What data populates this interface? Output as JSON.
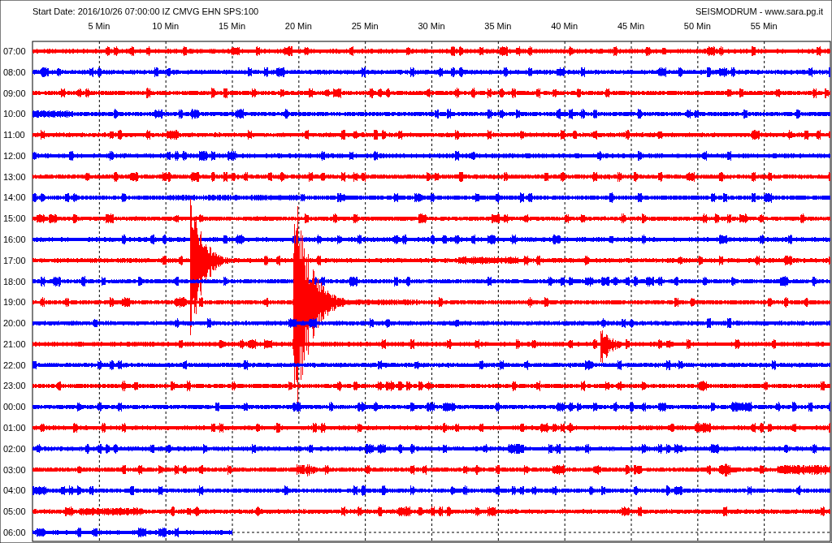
{
  "header": {
    "start_info": "Start Date: 2016/10/26 07:00:00 IZ CMVG EHN SPS:100",
    "site": "SEISMODRUM - www.sara.pg.it"
  },
  "x_ticks": [
    "5 Min",
    "10 Min",
    "15 Min",
    "20 Min",
    "25 Min",
    "30 Min",
    "35 Min",
    "40 Min",
    "45 Min",
    "50 Min",
    "55 Min"
  ],
  "rows": [
    {
      "label": "07:00",
      "color": "#ff0000"
    },
    {
      "label": "08:00",
      "color": "#0000ff"
    },
    {
      "label": "09:00",
      "color": "#ff0000"
    },
    {
      "label": "10:00",
      "color": "#0000ff"
    },
    {
      "label": "11:00",
      "color": "#ff0000"
    },
    {
      "label": "12:00",
      "color": "#0000ff"
    },
    {
      "label": "13:00",
      "color": "#ff0000"
    },
    {
      "label": "14:00",
      "color": "#0000ff"
    },
    {
      "label": "15:00",
      "color": "#ff0000"
    },
    {
      "label": "16:00",
      "color": "#0000ff"
    },
    {
      "label": "17:00",
      "color": "#ff0000"
    },
    {
      "label": "18:00",
      "color": "#0000ff"
    },
    {
      "label": "19:00",
      "color": "#ff0000"
    },
    {
      "label": "20:00",
      "color": "#0000ff"
    },
    {
      "label": "21:00",
      "color": "#ff0000"
    },
    {
      "label": "22:00",
      "color": "#0000ff"
    },
    {
      "label": "23:00",
      "color": "#ff0000"
    },
    {
      "label": "00:00",
      "color": "#0000ff"
    },
    {
      "label": "01:00",
      "color": "#ff0000"
    },
    {
      "label": "02:00",
      "color": "#0000ff"
    },
    {
      "label": "03:00",
      "color": "#ff0000"
    },
    {
      "label": "04:00",
      "color": "#0000ff"
    },
    {
      "label": "05:00",
      "color": "#ff0000"
    },
    {
      "label": "06:00",
      "color": "#0000ff"
    }
  ]
}
